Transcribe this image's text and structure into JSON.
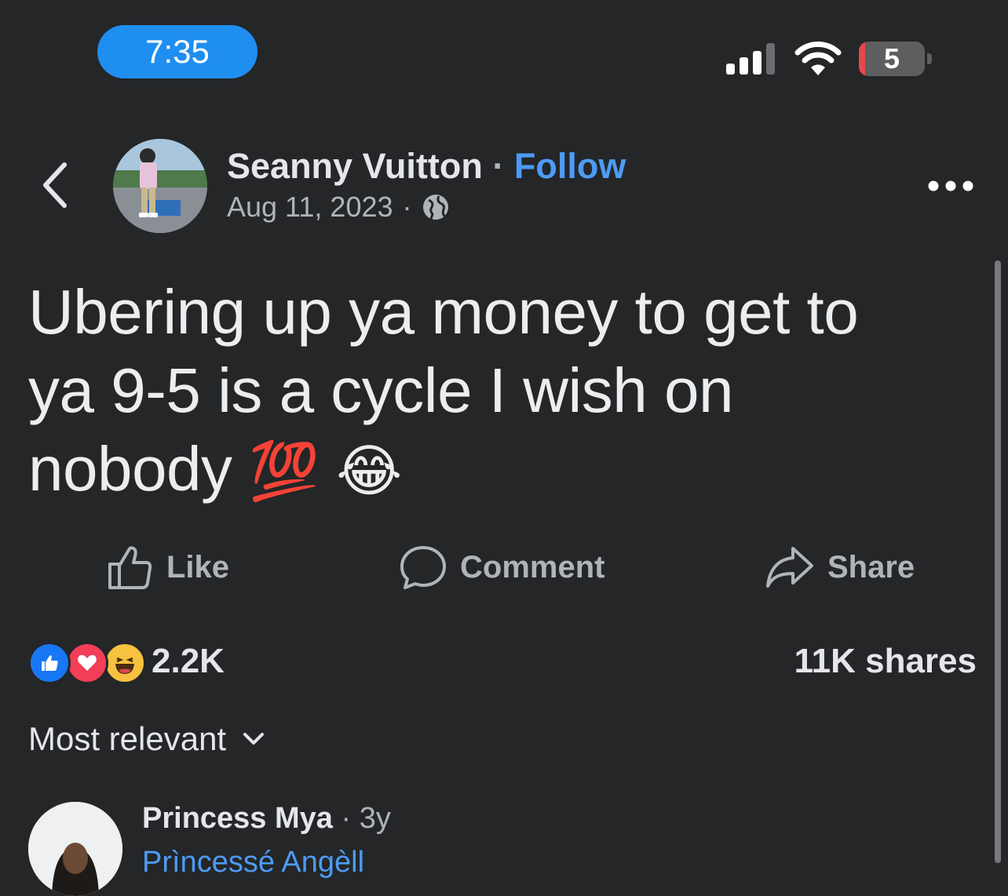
{
  "status_bar": {
    "time": "7:35",
    "battery_level": "5"
  },
  "post": {
    "author": "Seanny Vuitton",
    "separator": "·",
    "follow_label": "Follow",
    "date": "Aug 11, 2023",
    "date_separator": "·",
    "visibility_icon": "globe-icon",
    "text": "Ubering up ya money to get to ya 9-5 is a cycle I wish on nobody",
    "emoji_1": "💯",
    "emoji_2": "😂"
  },
  "actions": {
    "like_label": "Like",
    "comment_label": "Comment",
    "share_label": "Share"
  },
  "engagement": {
    "reaction_icons": [
      "like-icon",
      "love-icon",
      "haha-icon"
    ],
    "reaction_count": "2.2K",
    "shares": "11K shares"
  },
  "comments": {
    "sort_label": "Most relevant",
    "first": {
      "author": "Princess Mya",
      "age": "3y",
      "tagged": "Prìncessé Angèll"
    }
  },
  "colors": {
    "background": "#242628",
    "accent": "#4d9bf5",
    "time_pill": "#1f8ef1",
    "muted_text": "#b0b3b8"
  }
}
